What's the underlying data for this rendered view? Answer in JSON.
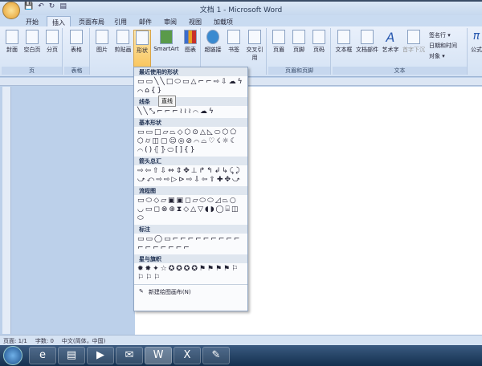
{
  "window": {
    "title": "文档 1 - Microsoft Word"
  },
  "tabs": [
    "开始",
    "插入",
    "页面布局",
    "引用",
    "邮件",
    "审阅",
    "视图",
    "加载项"
  ],
  "active_tab": "插入",
  "ribbon": {
    "groups": [
      {
        "label": "页",
        "buttons": [
          "封面",
          "空白页",
          "分页"
        ]
      },
      {
        "label": "表格",
        "buttons": [
          "表格"
        ]
      },
      {
        "label": "",
        "buttons": [
          "图片",
          "剪贴画",
          "形状",
          "SmartArt",
          "图表"
        ]
      },
      {
        "label": "",
        "buttons": [
          "超链接",
          "书签",
          "交叉引用"
        ]
      },
      {
        "label": "页眉和页脚",
        "buttons": [
          "页眉",
          "页脚",
          "页码"
        ]
      },
      {
        "label": "文本",
        "buttons": [
          "文本框",
          "文档部件",
          "艺术字",
          "首字下沉"
        ],
        "small": [
          "签名行 ▾",
          "日期和时间",
          "对象 ▾"
        ]
      },
      {
        "label": "",
        "buttons": [
          "公式"
        ]
      }
    ]
  },
  "shapes_menu": {
    "sections": [
      {
        "title": "最近使用的形状",
        "glyphs": "▭▭╲╲□⬭▭△⌐⌐⇨⇩☁ϟ⌒⌂{}"
      },
      {
        "title": "线条",
        "glyphs": "╲╲⤡⌐⌐⌐≀≀≀⌒☁ϟ"
      },
      {
        "title": "基本形状",
        "glyphs": "▭▭□▱⏢◇⬡⊙△◺⬭⬡⬠⬡⌭◫▢☺◎⊘⌒⌓♡☇☼☾⌒()⦃⦄⬭[]{}"
      },
      {
        "title": "箭头总汇",
        "glyphs": "⇨⇦⇧⇩⇔⇕✥⊥↱↰↲↳⤹⤸⤻⤺⇨⇨▷⊳⇨⇩⇦⇧✚✥⤻"
      },
      {
        "title": "流程图",
        "glyphs": "▭⬭◇▱▣▣◻▱⬭⬭◿⏢○◡▭◻⊗⊕⧗◇△▽◖◗◯⌸◫⬭"
      },
      {
        "title": "标注",
        "glyphs": "▭▭◯▭⌐⌐⌐⌐⌐⌐⌐⌐⌐⌐⌐⌐⌐⌐⌐⌐"
      },
      {
        "title": "星与旗帜",
        "glyphs": "✹✸✦☆✪✪✪✪⚑⚑⚑⚑⚐⚐⚐⚐"
      }
    ],
    "footer": "新建绘图画布(N)",
    "tooltip": "直线"
  },
  "status": {
    "page": "页面: 1/1",
    "words": "字数: 0",
    "language": "中文(简体，中国)"
  },
  "taskbar": [
    "ie-icon",
    "explorer-icon",
    "media-player-icon",
    "outlook-icon",
    "word-icon",
    "excel-icon",
    "paint-icon"
  ]
}
